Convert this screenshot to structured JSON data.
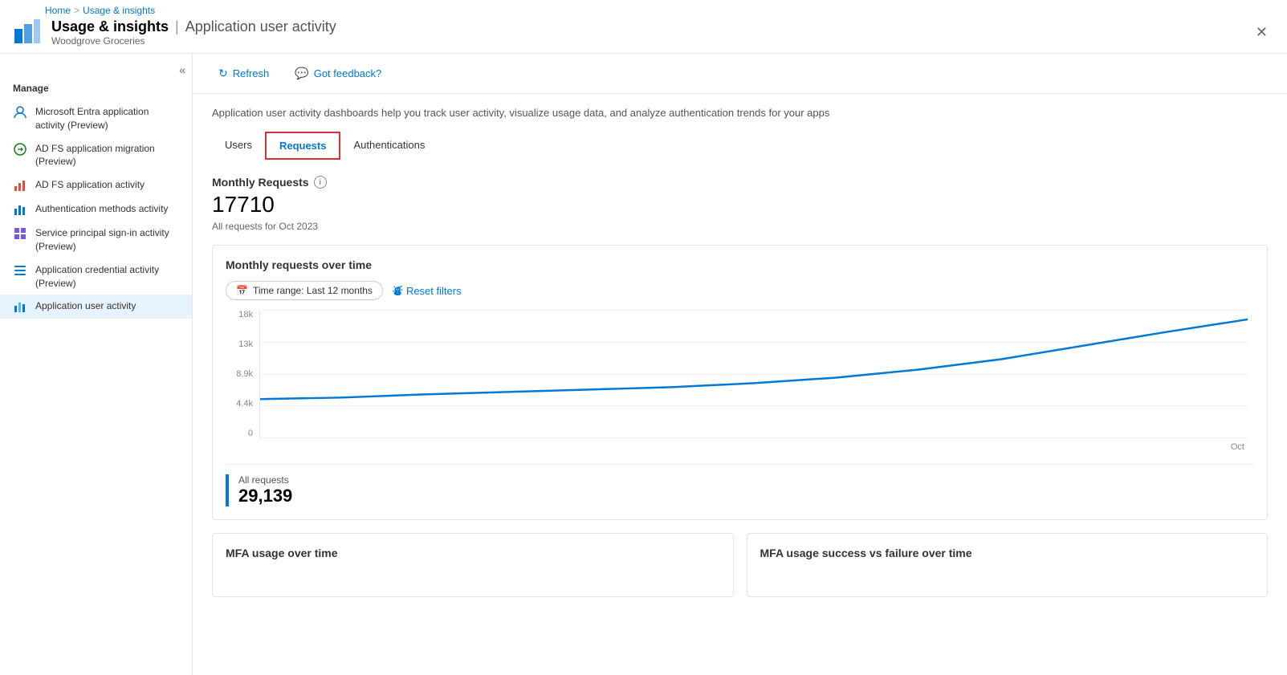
{
  "breadcrumb": {
    "home": "Home",
    "separator": ">",
    "current": "Usage & insights"
  },
  "header": {
    "title": "Usage & insights",
    "separator": "|",
    "subtitle": "Application user activity",
    "org": "Woodgrove Groceries",
    "close_label": "✕"
  },
  "toolbar": {
    "refresh_label": "Refresh",
    "feedback_label": "Got feedback?"
  },
  "description": "Application user activity dashboards help you track user activity, visualize usage data, and analyze authentication trends for your apps",
  "sidebar": {
    "manage_label": "Manage",
    "items": [
      {
        "id": "entra-activity",
        "label": "Microsoft Entra application activity (Preview)",
        "icon": "person-icon"
      },
      {
        "id": "adfs-migration",
        "label": "AD FS application migration (Preview)",
        "icon": "migrate-icon"
      },
      {
        "id": "adfs-activity",
        "label": "AD FS application activity",
        "icon": "activity-icon"
      },
      {
        "id": "auth-methods",
        "label": "Authentication methods activity",
        "icon": "chart-icon"
      },
      {
        "id": "sp-signin",
        "label": "Service principal sign-in activity (Preview)",
        "icon": "grid-icon"
      },
      {
        "id": "app-credential",
        "label": "Application credential activity (Preview)",
        "icon": "list-icon"
      },
      {
        "id": "app-user",
        "label": "Application user activity",
        "icon": "user-chart-icon",
        "active": true
      }
    ]
  },
  "tabs": [
    {
      "id": "users",
      "label": "Users",
      "active": false
    },
    {
      "id": "requests",
      "label": "Requests",
      "active": true
    },
    {
      "id": "authentications",
      "label": "Authentications",
      "active": false
    }
  ],
  "stats": {
    "title": "Monthly Requests",
    "number": "17710",
    "sub": "All requests for Oct 2023"
  },
  "chart": {
    "title": "Monthly requests over time",
    "time_range_label": "Time range: Last 12 months",
    "reset_filters_label": "Reset filters",
    "y_labels": [
      "18k",
      "13k",
      "8.9k",
      "4.4k",
      "0"
    ],
    "x_label": "Oct",
    "legend_label": "All requests",
    "legend_value": "29,139"
  },
  "bottom_panels": [
    {
      "id": "mfa-usage",
      "title": "MFA usage over time"
    },
    {
      "id": "mfa-success-failure",
      "title": "MFA usage success vs failure over time"
    }
  ]
}
